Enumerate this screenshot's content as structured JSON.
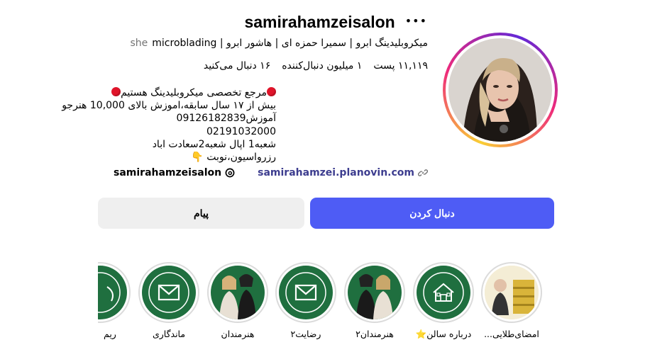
{
  "profile": {
    "username": "samirahamzeisalon",
    "more_icon": "more-horizontal-icon",
    "bio_line": "میکروبلیدینگ ابرو | سمیرا حمزه ای | هاشور ابرو | microblading",
    "pronouns": "she",
    "stats": {
      "posts": "۱۱,۱۱۹ پست",
      "followers": "۱ میلیون دنبال‌کننده",
      "following": "۱۶ دنبال می‌کنید"
    },
    "bio": {
      "line1": "مرجع تخصصی میکروبلیدینگ هستیم",
      "line2": "بیش از ۱۷ سال سابقه،اموزش بالای 10,000 هنرجو",
      "line3": "آموزش09126182839",
      "line4": "02191032000",
      "line5": "شعبه1 اپال شعبه2سعادت اباد",
      "line6": "رزرواسیون،نوبت"
    },
    "threads_handle": "samirahamzeisalon",
    "website": "samirahamzei.planovin.com"
  },
  "actions": {
    "follow_label": "دنبال کردن",
    "message_label": "پیام"
  },
  "highlights": [
    {
      "label": "امضای‌طلایی...",
      "type": "photo-gold"
    },
    {
      "label": "درباره سالن⭐",
      "type": "house"
    },
    {
      "label": "هنرمندان۲",
      "type": "photo-duo"
    },
    {
      "label": "رضایت۲",
      "type": "mail"
    },
    {
      "label": "هنرمندان",
      "type": "photo-duo"
    },
    {
      "label": "ماندگاری",
      "type": "mail"
    },
    {
      "label": "ریم",
      "type": "partial"
    }
  ],
  "colors": {
    "follow_button": "#4e5cf5",
    "message_button": "#efefef",
    "highlight_green": "#1f6f3f",
    "link": "#3d3d8f",
    "red_dot": "#e0142a"
  }
}
